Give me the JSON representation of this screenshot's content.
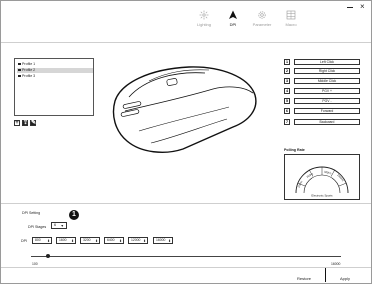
{
  "toolbar": {
    "tabs": [
      {
        "label": "Lighting",
        "icon": "lighting-icon"
      },
      {
        "label": "DPI",
        "icon": "cursor-arrow-icon"
      },
      {
        "label": "Parameter",
        "icon": "gear-icon"
      },
      {
        "label": "Macro",
        "icon": "macro-grid-icon"
      }
    ],
    "active_tab": "DPI"
  },
  "window_controls": {
    "minimize": "—",
    "close": "×"
  },
  "profiles": {
    "items": [
      "Profile 1",
      "Profile 2",
      "Profile 3"
    ],
    "selected": "Profile 2",
    "actions": [
      {
        "symbol": "+",
        "name": "add-profile"
      },
      {
        "symbol": "⇪",
        "name": "export-profile"
      },
      {
        "symbol": "✎",
        "name": "edit-profile"
      }
    ]
  },
  "button_mapping": [
    {
      "num": "1",
      "label": "Left Click"
    },
    {
      "num": "2",
      "label": "Right Click"
    },
    {
      "num": "3",
      "label": "Middle Click"
    },
    {
      "num": "4",
      "label": "PGV +"
    },
    {
      "num": "5",
      "label": "PGV -"
    },
    {
      "num": "6",
      "label": "Forward"
    },
    {
      "num": "7",
      "label": "Backward"
    }
  ],
  "polling_rate": {
    "title": "Polling Rate",
    "options": [
      "125Hz",
      "250Hz",
      "500Hz",
      "1000Hz"
    ],
    "brand": "Electronic Sports"
  },
  "dpi": {
    "section_title": "DPI Setting",
    "stages_label": "DPI Stages",
    "stages_value": "6",
    "badge": "1",
    "label": "DPI",
    "values": [
      "800",
      "1600",
      "3200",
      "6400",
      "12000",
      "16000"
    ],
    "slider_min": "100",
    "slider_max": "16000",
    "slider_fraction": 0.05
  },
  "footer": {
    "restore": "Restore",
    "apply": "Apply"
  },
  "colors": {
    "selected_profile": "#d6d6d6",
    "border": "#333333",
    "active_tab": "#111111"
  }
}
